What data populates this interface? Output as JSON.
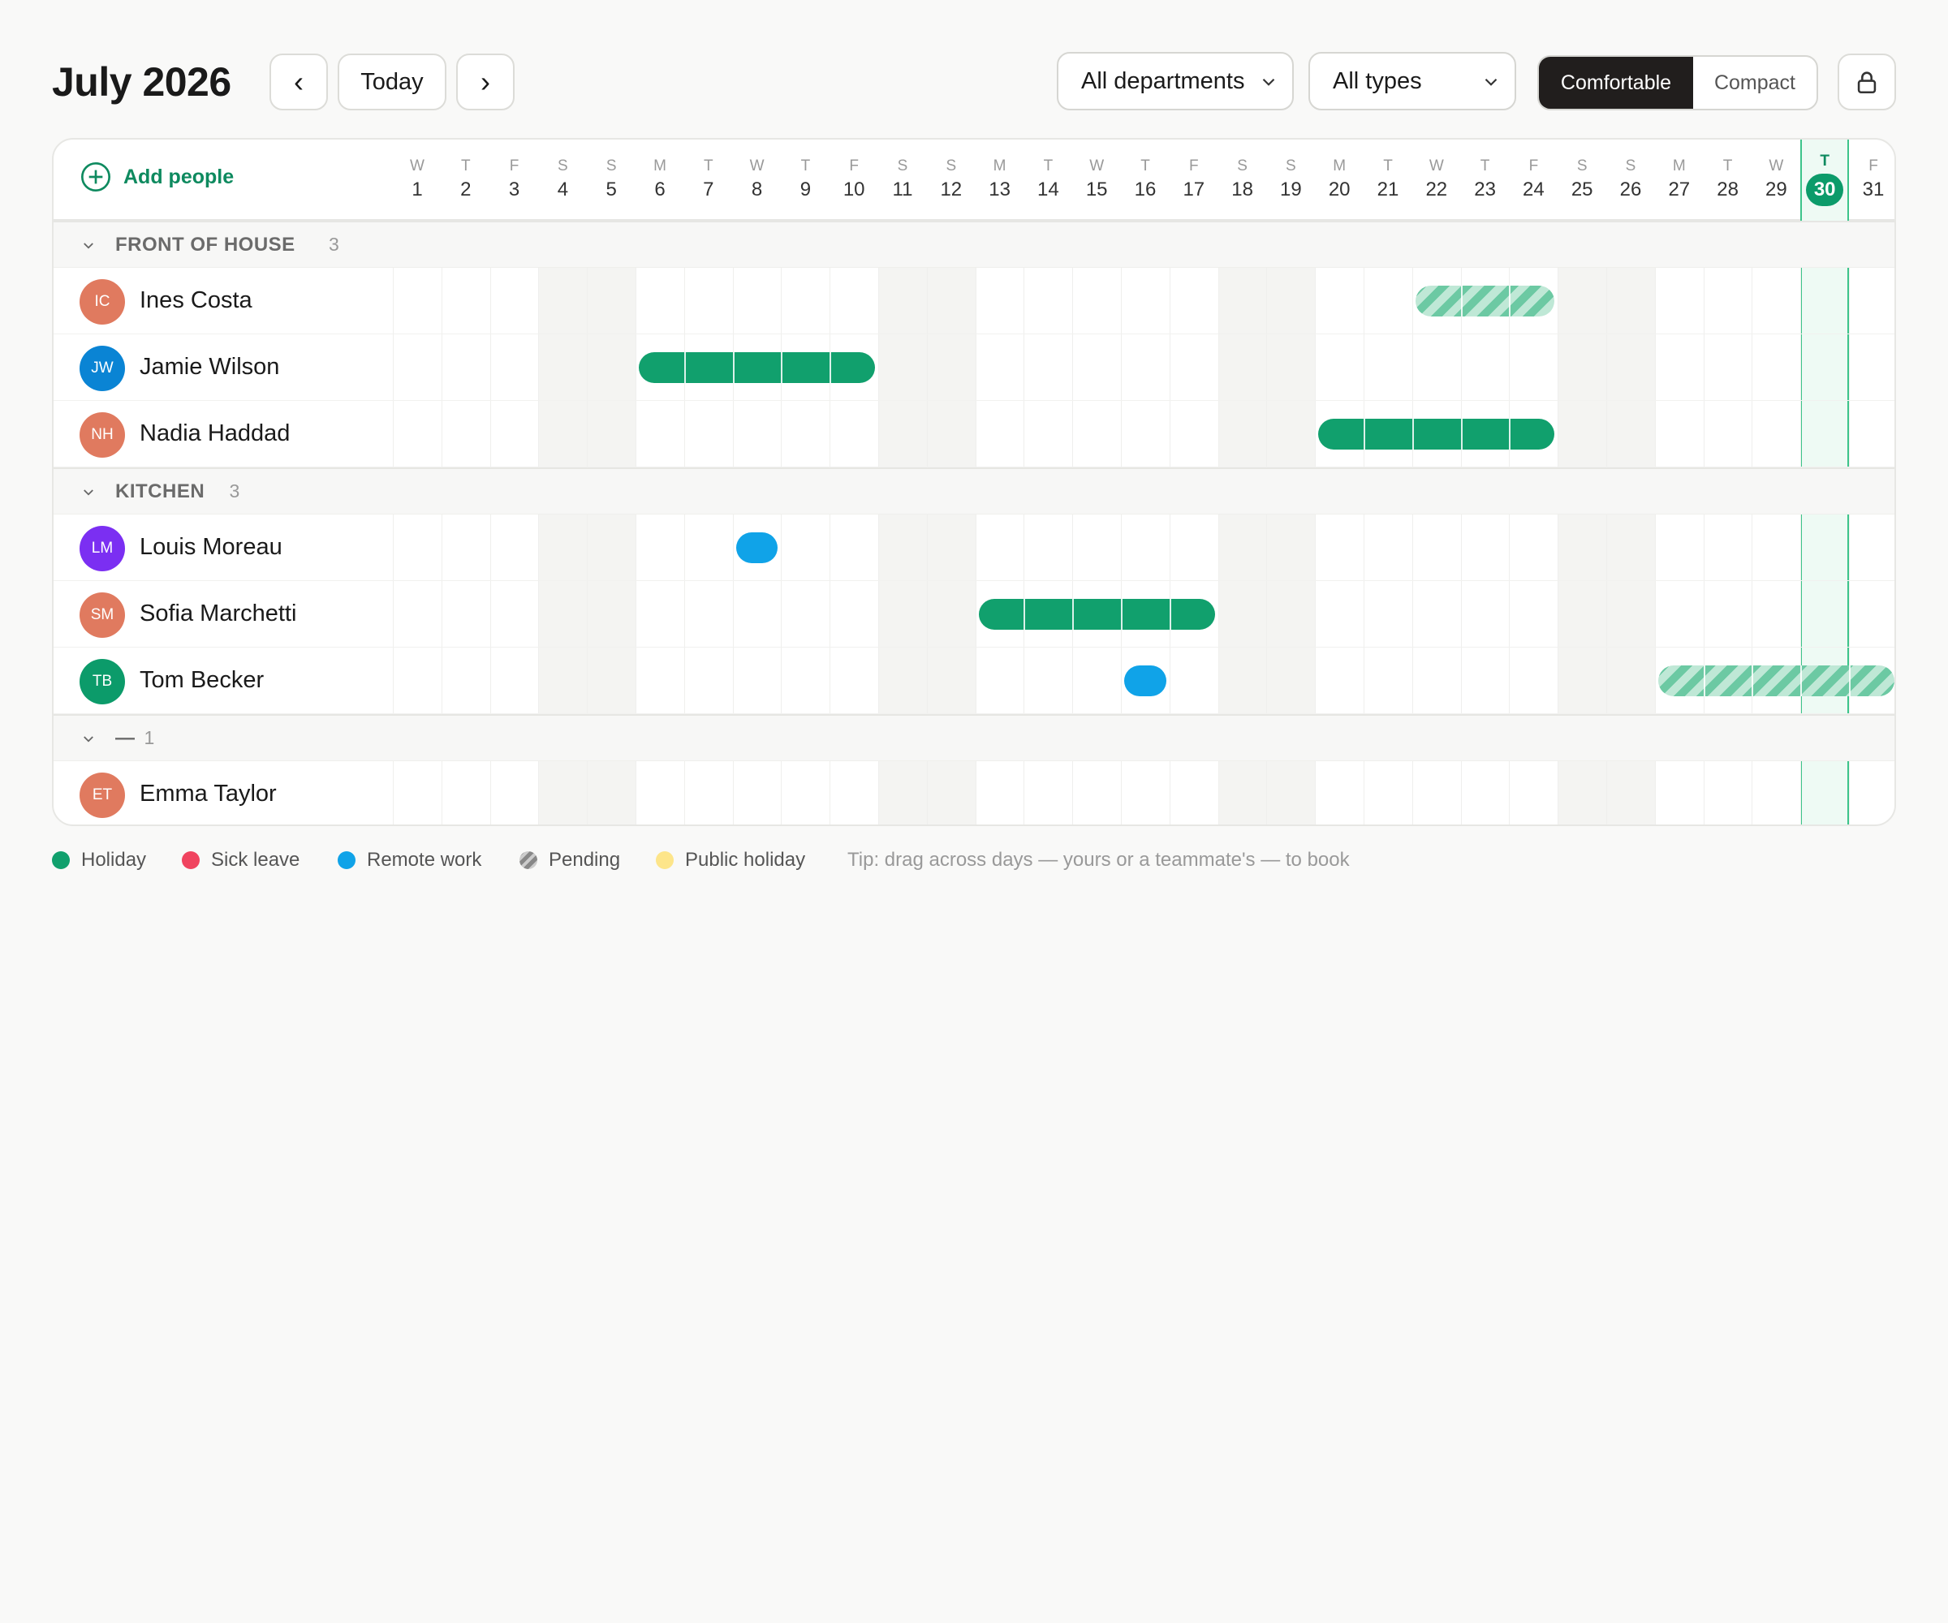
{
  "title": "July 2026",
  "nav": {
    "prev": "‹",
    "today": "Today",
    "next": "›"
  },
  "filters": {
    "department": "All departments",
    "type": "All types"
  },
  "density": {
    "active": "Comfortable",
    "other": "Compact"
  },
  "add_people": "Add people",
  "today_day": 30,
  "days": [
    {
      "d": "W",
      "n": "1"
    },
    {
      "d": "T",
      "n": "2"
    },
    {
      "d": "F",
      "n": "3"
    },
    {
      "d": "S",
      "n": "4"
    },
    {
      "d": "S",
      "n": "5"
    },
    {
      "d": "M",
      "n": "6"
    },
    {
      "d": "T",
      "n": "7"
    },
    {
      "d": "W",
      "n": "8"
    },
    {
      "d": "T",
      "n": "9"
    },
    {
      "d": "F",
      "n": "10"
    },
    {
      "d": "S",
      "n": "11"
    },
    {
      "d": "S",
      "n": "12"
    },
    {
      "d": "M",
      "n": "13"
    },
    {
      "d": "T",
      "n": "14"
    },
    {
      "d": "W",
      "n": "15"
    },
    {
      "d": "T",
      "n": "16"
    },
    {
      "d": "F",
      "n": "17"
    },
    {
      "d": "S",
      "n": "18"
    },
    {
      "d": "S",
      "n": "19"
    },
    {
      "d": "M",
      "n": "20"
    },
    {
      "d": "T",
      "n": "21"
    },
    {
      "d": "W",
      "n": "22"
    },
    {
      "d": "T",
      "n": "23"
    },
    {
      "d": "F",
      "n": "24"
    },
    {
      "d": "S",
      "n": "25"
    },
    {
      "d": "S",
      "n": "26"
    },
    {
      "d": "M",
      "n": "27"
    },
    {
      "d": "T",
      "n": "28"
    },
    {
      "d": "W",
      "n": "29"
    },
    {
      "d": "T",
      "n": "30"
    },
    {
      "d": "F",
      "n": "31"
    }
  ],
  "groups": [
    {
      "name": "FRONT OF HOUSE",
      "count": "3",
      "people": [
        {
          "initials": "IC",
          "name": "Ines Costa",
          "color": "#e07a5f",
          "bookings": [
            {
              "type": "pending",
              "start": 22,
              "end": 24
            }
          ]
        },
        {
          "initials": "JW",
          "name": "Jamie Wilson",
          "color": "#0a84d4",
          "bookings": [
            {
              "type": "holiday",
              "start": 6,
              "end": 10
            }
          ]
        },
        {
          "initials": "NH",
          "name": "Nadia Haddad",
          "color": "#e07a5f",
          "bookings": [
            {
              "type": "holiday",
              "start": 20,
              "end": 24
            }
          ]
        }
      ]
    },
    {
      "name": "KITCHEN",
      "count": "3",
      "people": [
        {
          "initials": "LM",
          "name": "Louis Moreau",
          "color": "#7b2ff2",
          "bookings": [
            {
              "type": "remote",
              "start": 8,
              "end": 8
            }
          ]
        },
        {
          "initials": "SM",
          "name": "Sofia Marchetti",
          "color": "#e07a5f",
          "bookings": [
            {
              "type": "holiday",
              "start": 13,
              "end": 17
            }
          ]
        },
        {
          "initials": "TB",
          "name": "Tom Becker",
          "color": "#0c9b6a",
          "bookings": [
            {
              "type": "remote",
              "start": 16,
              "end": 16
            },
            {
              "type": "pending",
              "start": 27,
              "end": 31
            }
          ]
        }
      ]
    },
    {
      "name": "—",
      "count": "1",
      "people": [
        {
          "initials": "ET",
          "name": "Emma Taylor",
          "color": "#e07a5f",
          "bookings": []
        }
      ]
    }
  ],
  "legend": [
    {
      "label": "Holiday",
      "color": "#11a06d",
      "icon": "holiday-dot"
    },
    {
      "label": "Sick leave",
      "color": "#f0445f",
      "icon": "sick-dot"
    },
    {
      "label": "Remote work",
      "color": "#10a3e8",
      "icon": "remote-dot"
    },
    {
      "label": "Pending",
      "color": "#9a9a9a",
      "icon": "pending-dot"
    },
    {
      "label": "Public holiday",
      "color": "#fde58a",
      "icon": "public-holiday-dot"
    }
  ],
  "tip": "Tip: drag across days — yours or a teammate's — to book"
}
